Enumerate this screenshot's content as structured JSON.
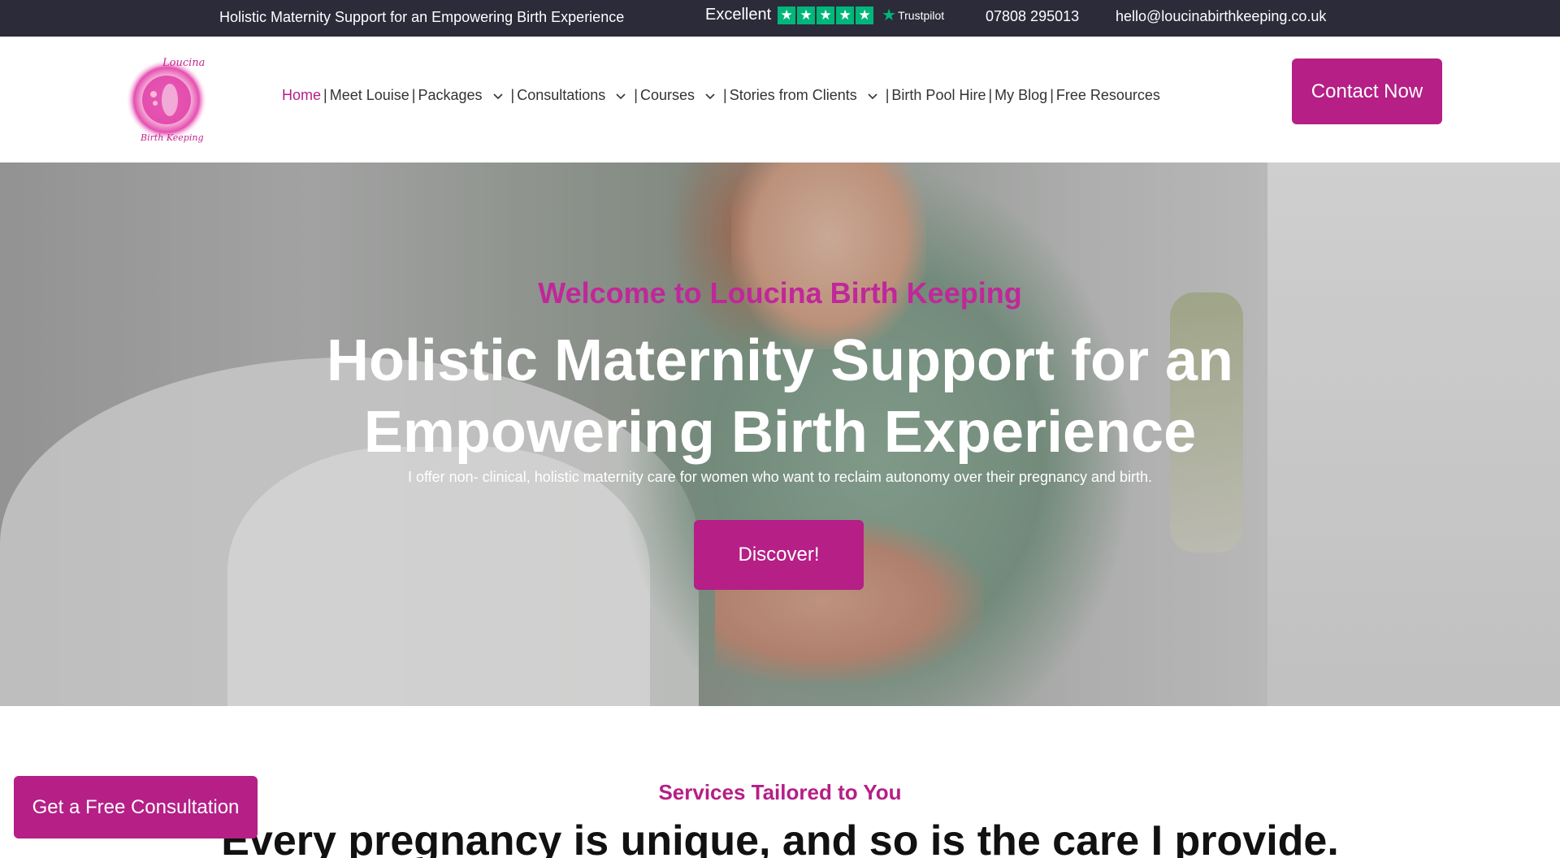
{
  "topbar": {
    "tagline": "Holistic Maternity Support for an Empowering Birth Experience",
    "trust_rating": "Excellent",
    "trust_stars": 5,
    "trust_brand": "Trustpilot",
    "phone": "07808 295013",
    "email": "hello@loucinabirthkeeping.co.uk"
  },
  "logo": {
    "top_text": "Loucina",
    "bottom_text": "Birth Keeping"
  },
  "nav": {
    "items": [
      {
        "label": "Home",
        "active": true,
        "dropdown": false
      },
      {
        "label": "Meet Louise",
        "active": false,
        "dropdown": false
      },
      {
        "label": "Packages",
        "active": false,
        "dropdown": true
      },
      {
        "label": "Consultations",
        "active": false,
        "dropdown": true
      },
      {
        "label": "Courses",
        "active": false,
        "dropdown": true
      },
      {
        "label": "Stories from Clients",
        "active": false,
        "dropdown": true
      },
      {
        "label": "Birth Pool Hire",
        "active": false,
        "dropdown": false
      },
      {
        "label": "My Blog",
        "active": false,
        "dropdown": false
      },
      {
        "label": "Free Resources",
        "active": false,
        "dropdown": false
      }
    ],
    "separator": "|"
  },
  "header": {
    "contact_label": "Contact Now"
  },
  "hero": {
    "kicker": "Welcome to Loucina Birth Keeping",
    "title_line1": "Holistic Maternity Support for an",
    "title_line2": "Empowering Birth Experience",
    "subtitle": "I offer non- clinical, holistic maternity care for women who want to reclaim autonomy over their pregnancy and birth.",
    "cta_label": "Discover!"
  },
  "services": {
    "kicker": "Services Tailored to You",
    "title": "Every pregnancy is unique, and so is the care I provide."
  },
  "floating": {
    "consult_label": "Get a Free Consultation"
  },
  "colors": {
    "brand": "#b51f86",
    "topbar_bg": "#2b2b3a",
    "trust_green": "#00b67a"
  }
}
